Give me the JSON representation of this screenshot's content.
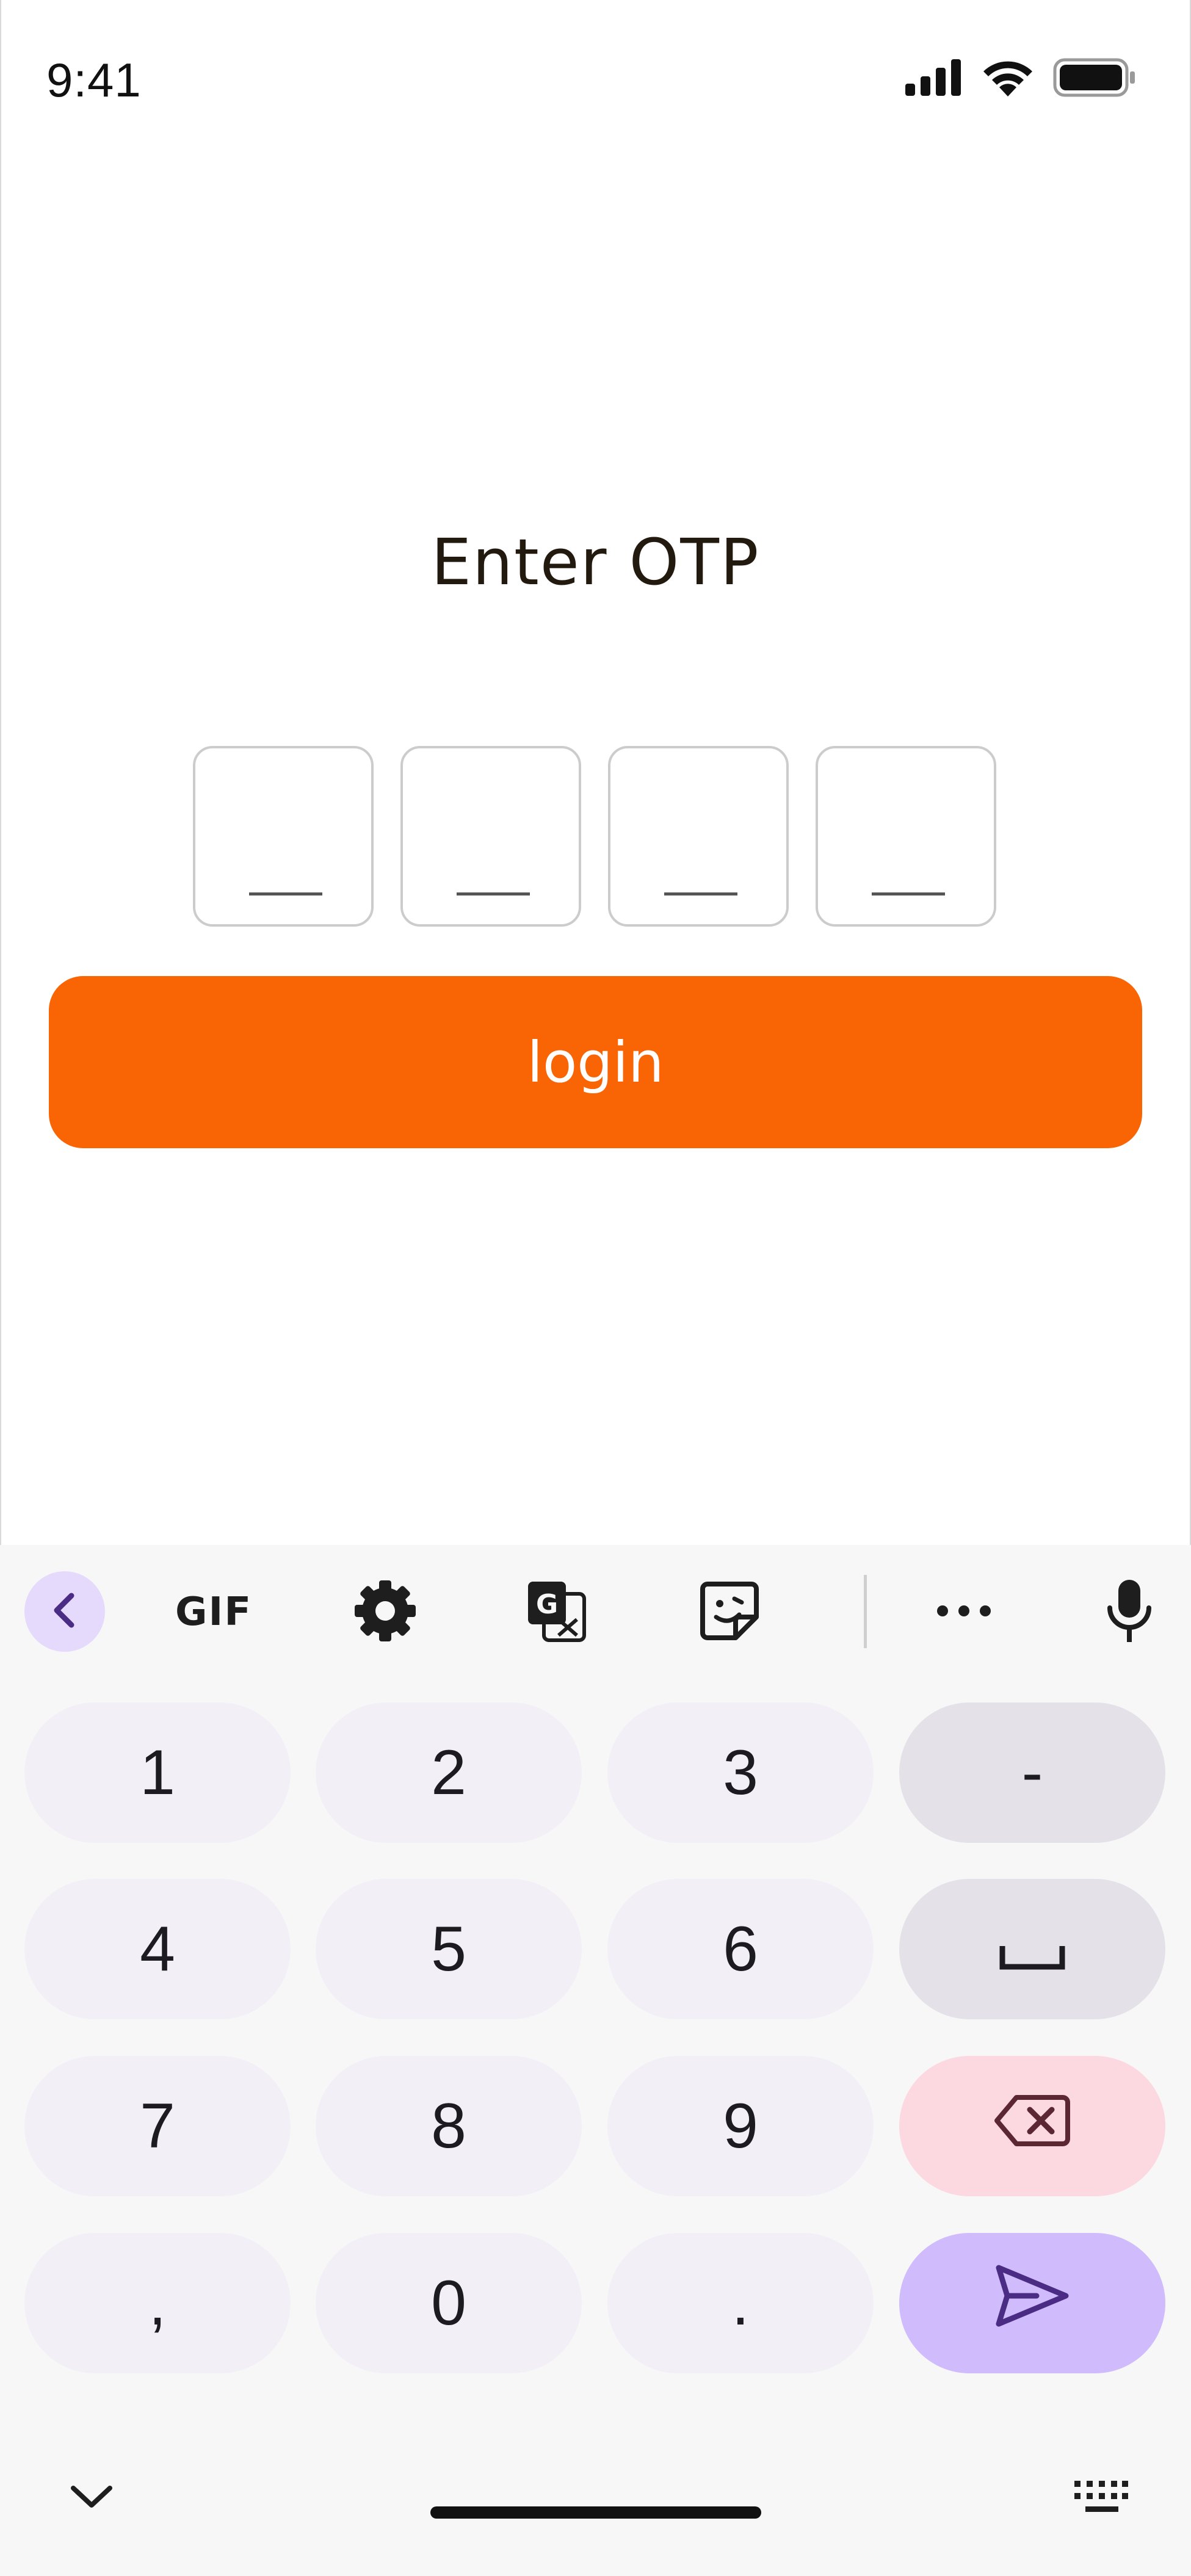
{
  "status_bar": {
    "time": "9:41",
    "icons": [
      "signal-icon",
      "wifi-icon",
      "battery-icon"
    ]
  },
  "screen": {
    "title": "Enter OTP",
    "otp_placeholders": [
      "_",
      "_",
      "_",
      "_"
    ],
    "login_label": "login"
  },
  "keyboard": {
    "toolbar": {
      "back": "chevron-left-icon",
      "gif_label": "GIF",
      "settings": "gear-icon",
      "translate": "translate-icon",
      "sticker": "sticker-icon",
      "more": "more-horizontal-icon",
      "mic": "microphone-icon"
    },
    "keys": {
      "row1": [
        "1",
        "2",
        "3",
        "-"
      ],
      "row2": [
        "4",
        "5",
        "6"
      ],
      "row3": [
        "7",
        "8",
        "9"
      ],
      "row4": [
        ",",
        "0",
        "."
      ]
    },
    "special": [
      "space-icon",
      "backspace-icon",
      "send-icon"
    ],
    "bottom": [
      "chevron-down-icon",
      "keyboard-icon"
    ]
  },
  "colors": {
    "accent": "#f96505",
    "title_text": "#231a0f",
    "key_bg": "#f3eff7",
    "key_fn_bg": "#e5e1e9",
    "key_delete_bg": "#fcd9e1",
    "key_send_bg": "#d0bcfc",
    "back_pill_bg": "#e6dafc"
  }
}
